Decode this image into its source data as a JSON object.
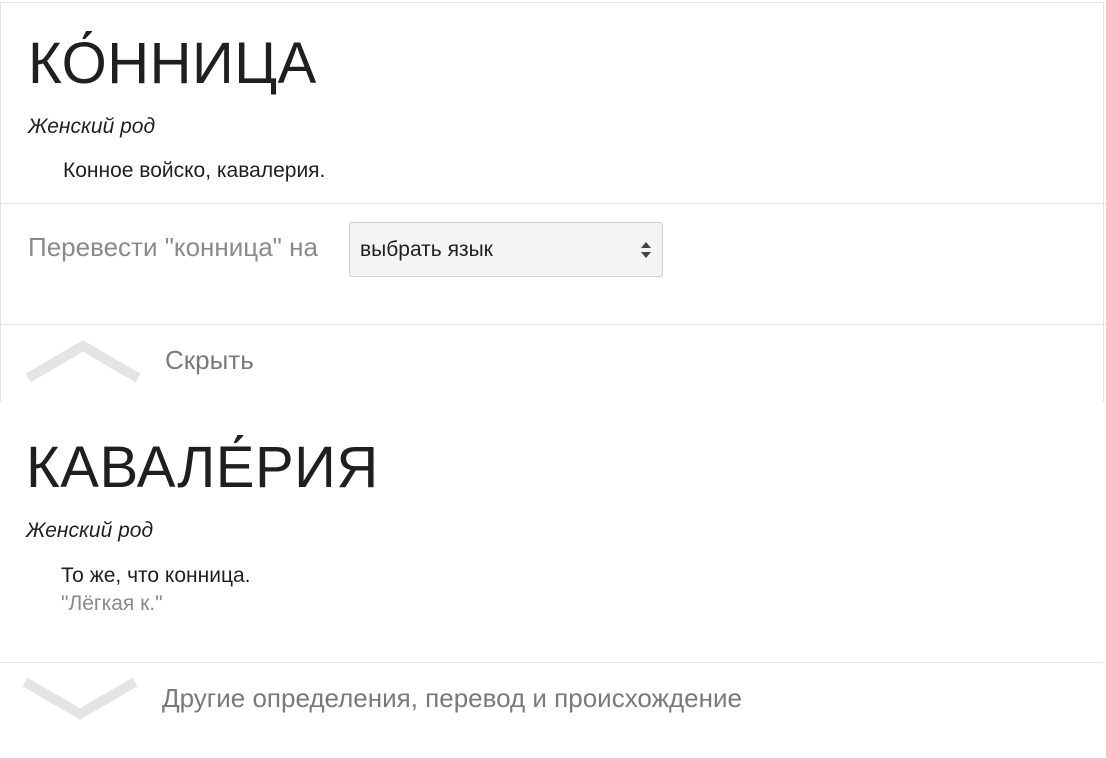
{
  "entry1": {
    "word": "КО́ННИЦА",
    "gender": "Женский род",
    "definition": "Конное войско, кавалерия."
  },
  "translate": {
    "label": "Перевести \"конница\" на",
    "select_value": "выбрать язык"
  },
  "hide_label": "Скрыть",
  "entry2": {
    "word": "КАВАЛЕ́РИЯ",
    "gender": "Женский род",
    "definition": "То же, что конница.",
    "example": "\"Лёгкая к.\""
  },
  "more_label": "Другие определения, перевод и происхождение"
}
